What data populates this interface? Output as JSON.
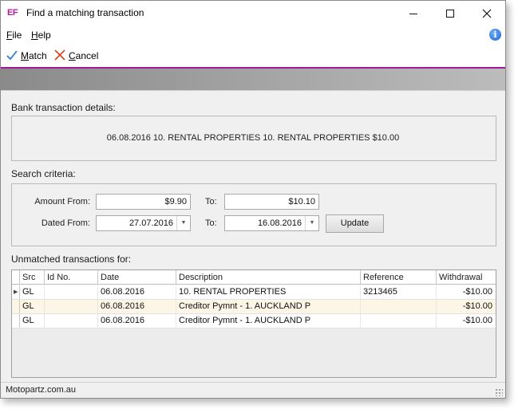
{
  "window": {
    "app_logo": "EF",
    "title": "Find a matching transaction"
  },
  "menu": {
    "file_first": "F",
    "file_rest": "ile",
    "help_first": "H",
    "help_rest": "elp"
  },
  "toolbar": {
    "match_first": "M",
    "match_rest": "atch",
    "cancel_first": "C",
    "cancel_rest": "ancel"
  },
  "bank": {
    "label": "Bank transaction details:",
    "details": "06.08.2016  10. RENTAL PROPERTIES 10. RENTAL PROPERTIES $10.00"
  },
  "search": {
    "label": "Search criteria:",
    "amount_from_label": "Amount From:",
    "amount_from": "$9.90",
    "amount_to_label": "To:",
    "amount_to": "$10.10",
    "dated_from_label": "Dated From:",
    "dated_from": "27.07.2016",
    "dated_to_label": "To:",
    "dated_to": "16.08.2016",
    "update_label": "Update"
  },
  "unmatched": {
    "label": "Unmatched transactions for:",
    "columns": [
      "Src",
      "Id No.",
      "Date",
      "Description",
      "Reference",
      "Withdrawal"
    ],
    "rows": [
      {
        "src": "GL",
        "id": "",
        "date": "06.08.2016",
        "description": "10. RENTAL PROPERTIES",
        "reference": "3213465",
        "withdrawal": "-$10.00"
      },
      {
        "src": "GL",
        "id": "",
        "date": "06.08.2016",
        "description": "Creditor Pymnt - 1. AUCKLAND P",
        "reference": "",
        "withdrawal": "-$10.00"
      },
      {
        "src": "GL",
        "id": "",
        "date": "06.08.2016",
        "description": "Creditor Pymnt - 1. AUCKLAND P",
        "reference": "",
        "withdrawal": "-$10.00"
      }
    ]
  },
  "status": {
    "text": "Motopartz.com.au"
  },
  "colors": {
    "accent": "#a21a9a",
    "selected_row": "#fdf6e6"
  }
}
